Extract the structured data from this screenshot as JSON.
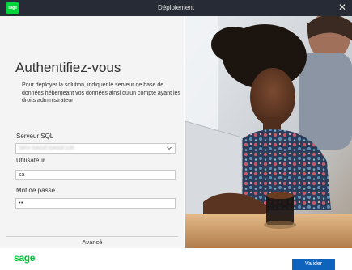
{
  "window": {
    "title": "Déploiement",
    "logo_text": "sage",
    "close_glyph": "✕"
  },
  "panel": {
    "heading": "Authentifiez-vous",
    "description": "Pour déployer la solution, indiquer le serveur de base de données hébergeant vos données ainsi qu'un compte ayant les droits administrateur"
  },
  "form": {
    "sql_server": {
      "label": "Serveur SQL",
      "value": "SRV-SAGE\\SAGE100"
    },
    "user": {
      "label": "Utilisateur",
      "value": "sa"
    },
    "password": {
      "label": "Mot de passe",
      "value": "••"
    }
  },
  "advanced_label": "Avancé",
  "footer": {
    "brand": "sage",
    "validate_label": "Valider"
  },
  "colors": {
    "titlebar": "#262b35",
    "brand_green": "#00c23a",
    "primary_button": "#0e63bd"
  }
}
